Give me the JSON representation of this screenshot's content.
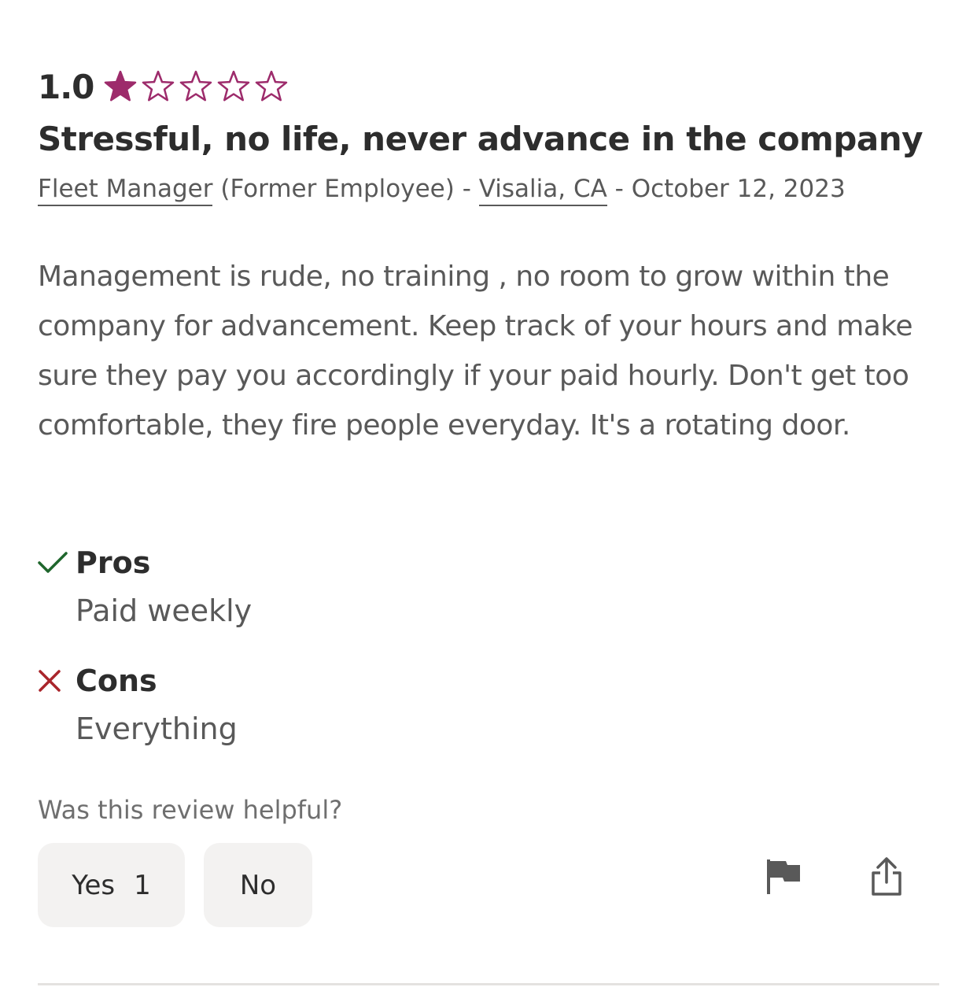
{
  "review": {
    "rating": "1.0",
    "rating_value": 1,
    "stars_total": 5,
    "title": "Stressful, no life, never advance in the company",
    "job_title": "Fleet Manager",
    "employment_status": "(Former Employee)",
    "separator": "-",
    "location": "Visalia, CA",
    "date": "October 12, 2023",
    "body": "Management is rude, no training , no room to grow within the company for advancement. Keep track of your hours and make sure they pay you accordingly if your paid hourly. Don't get too comfortable, they fire people everyday. It's a rotating door.",
    "pros": {
      "label": "Pros",
      "icon": "check-icon",
      "text": "Paid weekly"
    },
    "cons": {
      "label": "Cons",
      "icon": "x-icon",
      "text": "Everything"
    }
  },
  "helpful": {
    "question": "Was this review helpful?",
    "yes_label": "Yes",
    "yes_count": "1",
    "no_label": "No"
  },
  "actions": {
    "flag_icon": "flag-icon",
    "share_icon": "share-icon"
  },
  "colors": {
    "star_filled": "#9d2b6b",
    "star_outline": "#9d2b6b",
    "pros_check": "#1f662c",
    "cons_x": "#a9252b",
    "text_primary": "#2d2d2d",
    "text_secondary": "#595959",
    "button_bg": "#f3f2f1"
  }
}
